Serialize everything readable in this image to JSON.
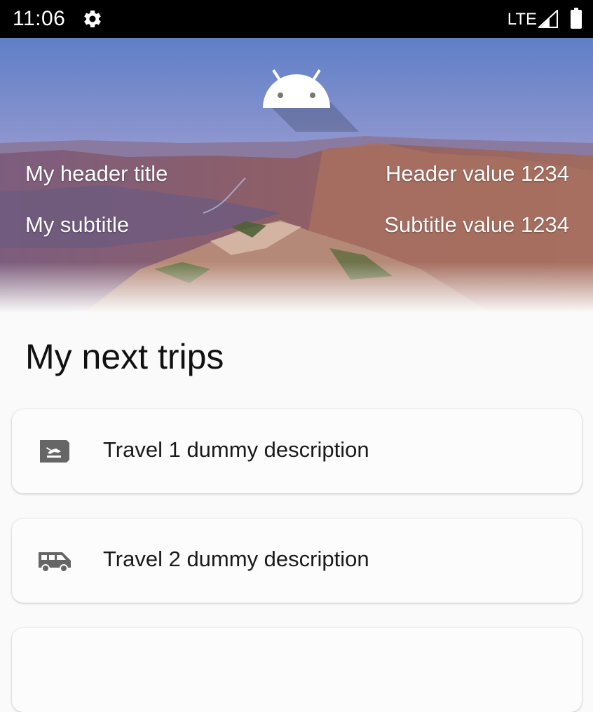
{
  "status_bar": {
    "time": "11:06",
    "network": "LTE",
    "settings_icon": "gear-icon",
    "signal_icon": "signal-icon",
    "battery_icon": "battery-icon"
  },
  "header": {
    "logo_icon": "android-icon",
    "title": "My header title",
    "title_value": "Header value 1234",
    "subtitle": "My subtitle",
    "subtitle_value": "Subtitle value 1234"
  },
  "section": {
    "title": "My next trips"
  },
  "trips": [
    {
      "icon": "flight-land-icon",
      "description": "Travel 1 dummy description"
    },
    {
      "icon": "shuttle-icon",
      "description": "Travel 2 dummy description"
    },
    {
      "icon": "",
      "description": ""
    }
  ],
  "colors": {
    "status_bar_bg": "#000000",
    "page_bg": "#fafafa",
    "card_bg": "#fcfcfc",
    "icon_gray": "#666666"
  }
}
